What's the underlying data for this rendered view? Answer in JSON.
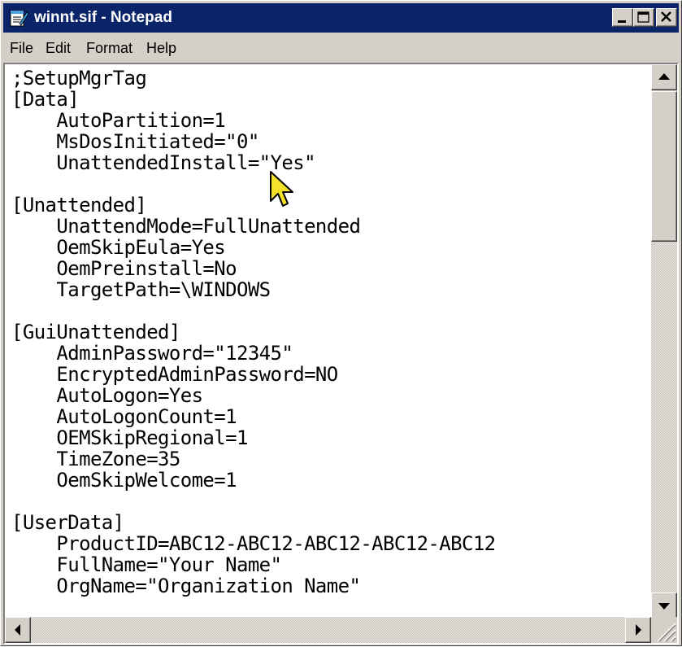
{
  "window": {
    "title": "winnt.sif - Notepad",
    "icon": "notepad-icon",
    "controls": [
      "minimize-icon",
      "maximize-icon",
      "close-icon"
    ]
  },
  "menu": {
    "items": [
      {
        "label": "File"
      },
      {
        "label": "Edit"
      },
      {
        "label": "Format"
      },
      {
        "label": "Help"
      }
    ]
  },
  "editor": {
    "lines": [
      ";SetupMgrTag",
      "[Data]",
      "    AutoPartition=1",
      "    MsDosInitiated=\"0\"",
      "    UnattendedInstall=\"Yes\"",
      "",
      "[Unattended]",
      "    UnattendMode=FullUnattended",
      "    OemSkipEula=Yes",
      "    OemPreinstall=No",
      "    TargetPath=\\WINDOWS",
      "",
      "[GuiUnattended]",
      "    AdminPassword=\"12345\"",
      "    EncryptedAdminPassword=NO",
      "    AutoLogon=Yes",
      "    AutoLogonCount=1",
      "    OEMSkipRegional=1",
      "    TimeZone=35",
      "    OemSkipWelcome=1",
      "",
      "[UserData]",
      "    ProductID=ABC12-ABC12-ABC12-ABC12-ABC12",
      "    FullName=\"Your Name\"",
      "    OrgName=\"Organization Name\""
    ]
  },
  "scrollbars": {
    "vertical": {
      "position": 0.0,
      "visible_fraction": 0.3
    },
    "horizontal": {
      "position": 0.0
    }
  },
  "colors": {
    "titlebar": "#0a246a",
    "title_text": "#ffffff",
    "chrome": "#d4d0c8",
    "editor_bg": "#ffffff"
  }
}
